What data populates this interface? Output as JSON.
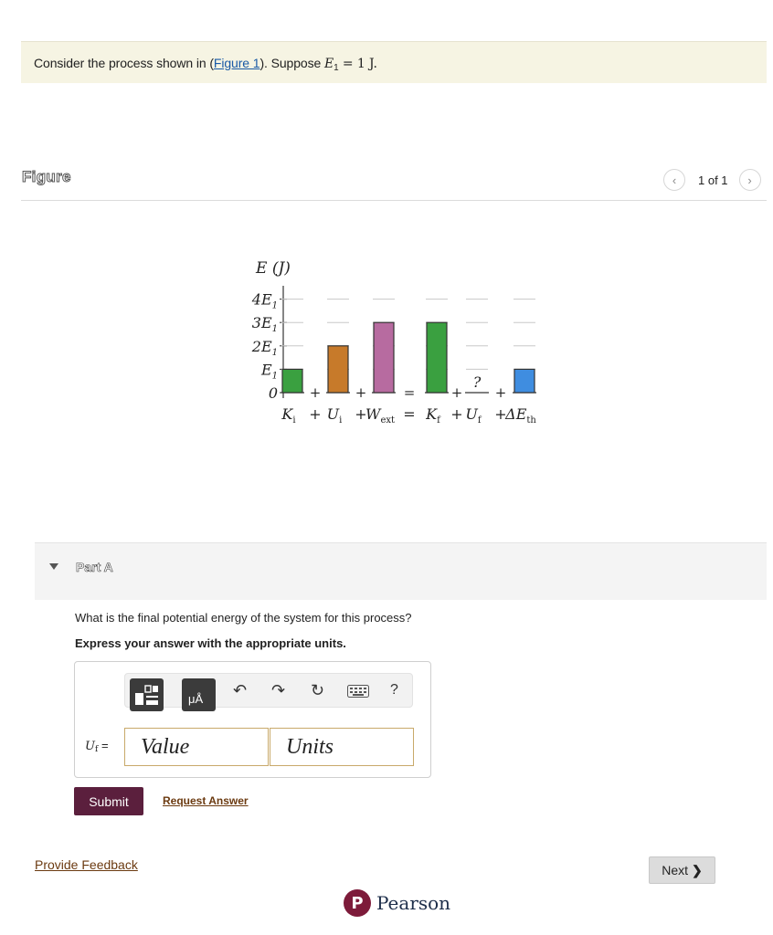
{
  "prompt": {
    "before": "Consider the process shown in (",
    "link": "Figure 1",
    "after": "). Suppose ",
    "math_var": "E",
    "math_sub": "1",
    "math_eq": " = 1 J."
  },
  "figure": {
    "label": "Figure",
    "page_count": "1 of 1",
    "prev_icon": "chevron-left-icon",
    "next_icon": "chevron-right-icon"
  },
  "chart": {
    "y_axis_title": "E (J)",
    "y_ticks": [
      "4E",
      "3E",
      "2E",
      "E",
      "0"
    ],
    "y_tick_sub": "1",
    "operators": [
      "+",
      "+",
      "=",
      "+",
      "+"
    ],
    "unknown_mark": "?",
    "terms": [
      {
        "main": "K",
        "sub": "i"
      },
      {
        "main": "U",
        "sub": "i"
      },
      {
        "main": "W",
        "sub": "ext"
      },
      {
        "main": "K",
        "sub": "f"
      },
      {
        "main": "U",
        "sub": "f"
      },
      {
        "main": "ΔE",
        "sub": "th"
      }
    ],
    "term_operators": [
      "+",
      "+",
      "=",
      "+",
      "+"
    ]
  },
  "chart_data": {
    "type": "bar",
    "categories": [
      "Ki",
      "Ui",
      "Wext",
      "Kf",
      "Uf",
      "ΔEth"
    ],
    "values": [
      1,
      2,
      3,
      3,
      null,
      1
    ],
    "ylabel": "E (J)",
    "yunit": "E1",
    "ylim": [
      0,
      4
    ],
    "colors": [
      "#3aa040",
      "#c77a2a",
      "#b76ba0",
      "#3aa040",
      null,
      "#3f8de0"
    ],
    "grid": true
  },
  "part_a": {
    "title": "Part A",
    "question": "What is the final potential energy of the system for this process?",
    "instruction": "Express your answer with the appropriate units."
  },
  "answer": {
    "label_var": "U",
    "label_sub": "f",
    "label_eq": "=",
    "value_placeholder": "Value",
    "units_placeholder": "Units",
    "toolbar_units_glyph": "μÅ",
    "help_glyph": "?"
  },
  "actions": {
    "submit": "Submit",
    "request_answer": "Request Answer",
    "feedback": "Provide Feedback",
    "next": "Next"
  },
  "footer": {
    "brand": "Pearson",
    "logo_letter": "P"
  }
}
